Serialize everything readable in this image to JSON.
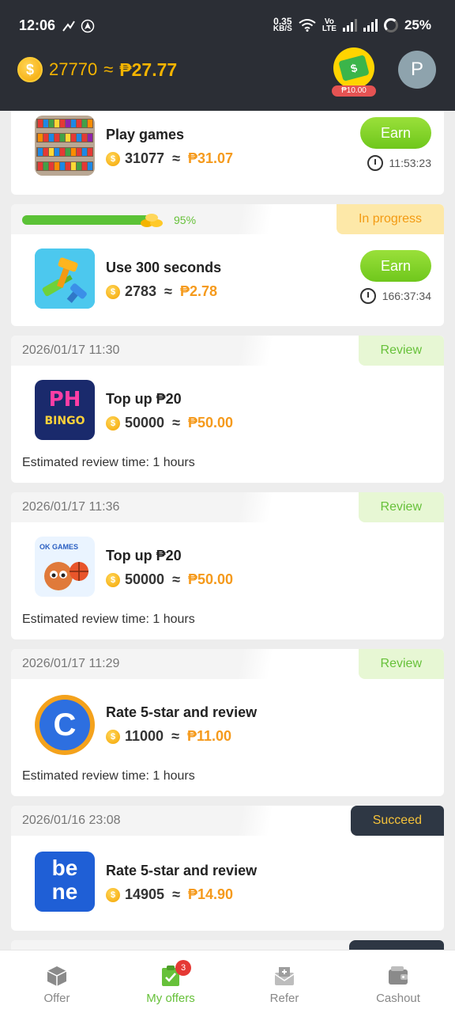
{
  "status_bar": {
    "time": "12:06",
    "speed_value": "0.35",
    "speed_unit": "KB/S",
    "network_label_1": "Vo",
    "network_label_2": "LTE",
    "battery": "25%"
  },
  "header": {
    "coin_balance": "27770",
    "approx": "≈",
    "peso_balance": "₱27.77",
    "cash_badge_label": "₱10.00",
    "avatar_initial": "P"
  },
  "cards": [
    {
      "title": "Play games",
      "coins": "31077",
      "peso": "₱31.07",
      "button": "Earn",
      "timer": "11:53:23"
    },
    {
      "progress_percent": "95%",
      "progress": 0.95,
      "tag": "In progress",
      "title": "Use 300 seconds",
      "coins": "2783",
      "peso": "₱2.78",
      "button": "Earn",
      "timer": "166:37:34"
    },
    {
      "date": "2026/01/17 11:30",
      "tag": "Review",
      "title": "Top up ₱20",
      "coins": "50000",
      "peso": "₱50.00",
      "review_time": "Estimated review time: 1 hours"
    },
    {
      "date": "2026/01/17 11:36",
      "tag": "Review",
      "title": "Top up ₱20",
      "coins": "50000",
      "peso": "₱50.00",
      "review_time": "Estimated review time: 1 hours"
    },
    {
      "date": "2026/01/17 11:29",
      "tag": "Review",
      "title": "Rate 5-star and review",
      "coins": "11000",
      "peso": "₱11.00",
      "review_time": "Estimated review time: 1 hours"
    },
    {
      "date": "2026/01/16 23:08",
      "tag": "Succeed",
      "title": "Rate 5-star and review",
      "coins": "14905",
      "peso": "₱14.90"
    }
  ],
  "app_icons": {
    "phbingo_text_1": "PH",
    "phbingo_text_2": "BINGO",
    "okgames_text": "OK GAMES",
    "c_letter": "C",
    "bene_text_1": "be",
    "bene_text_2": "ne"
  },
  "bottom_nav": {
    "items": [
      {
        "label": "Offer",
        "icon": "box-icon"
      },
      {
        "label": "My offers",
        "icon": "clipboard-check-icon",
        "badge": "3"
      },
      {
        "label": "Refer",
        "icon": "gift-envelope-icon"
      },
      {
        "label": "Cashout",
        "icon": "wallet-icon"
      }
    ],
    "active": "My offers"
  },
  "colors": {
    "header_bg": "#2b2e35",
    "accent_green": "#67c13a",
    "peso_orange": "#f59a1c",
    "coin_gold": "#f4b400"
  }
}
